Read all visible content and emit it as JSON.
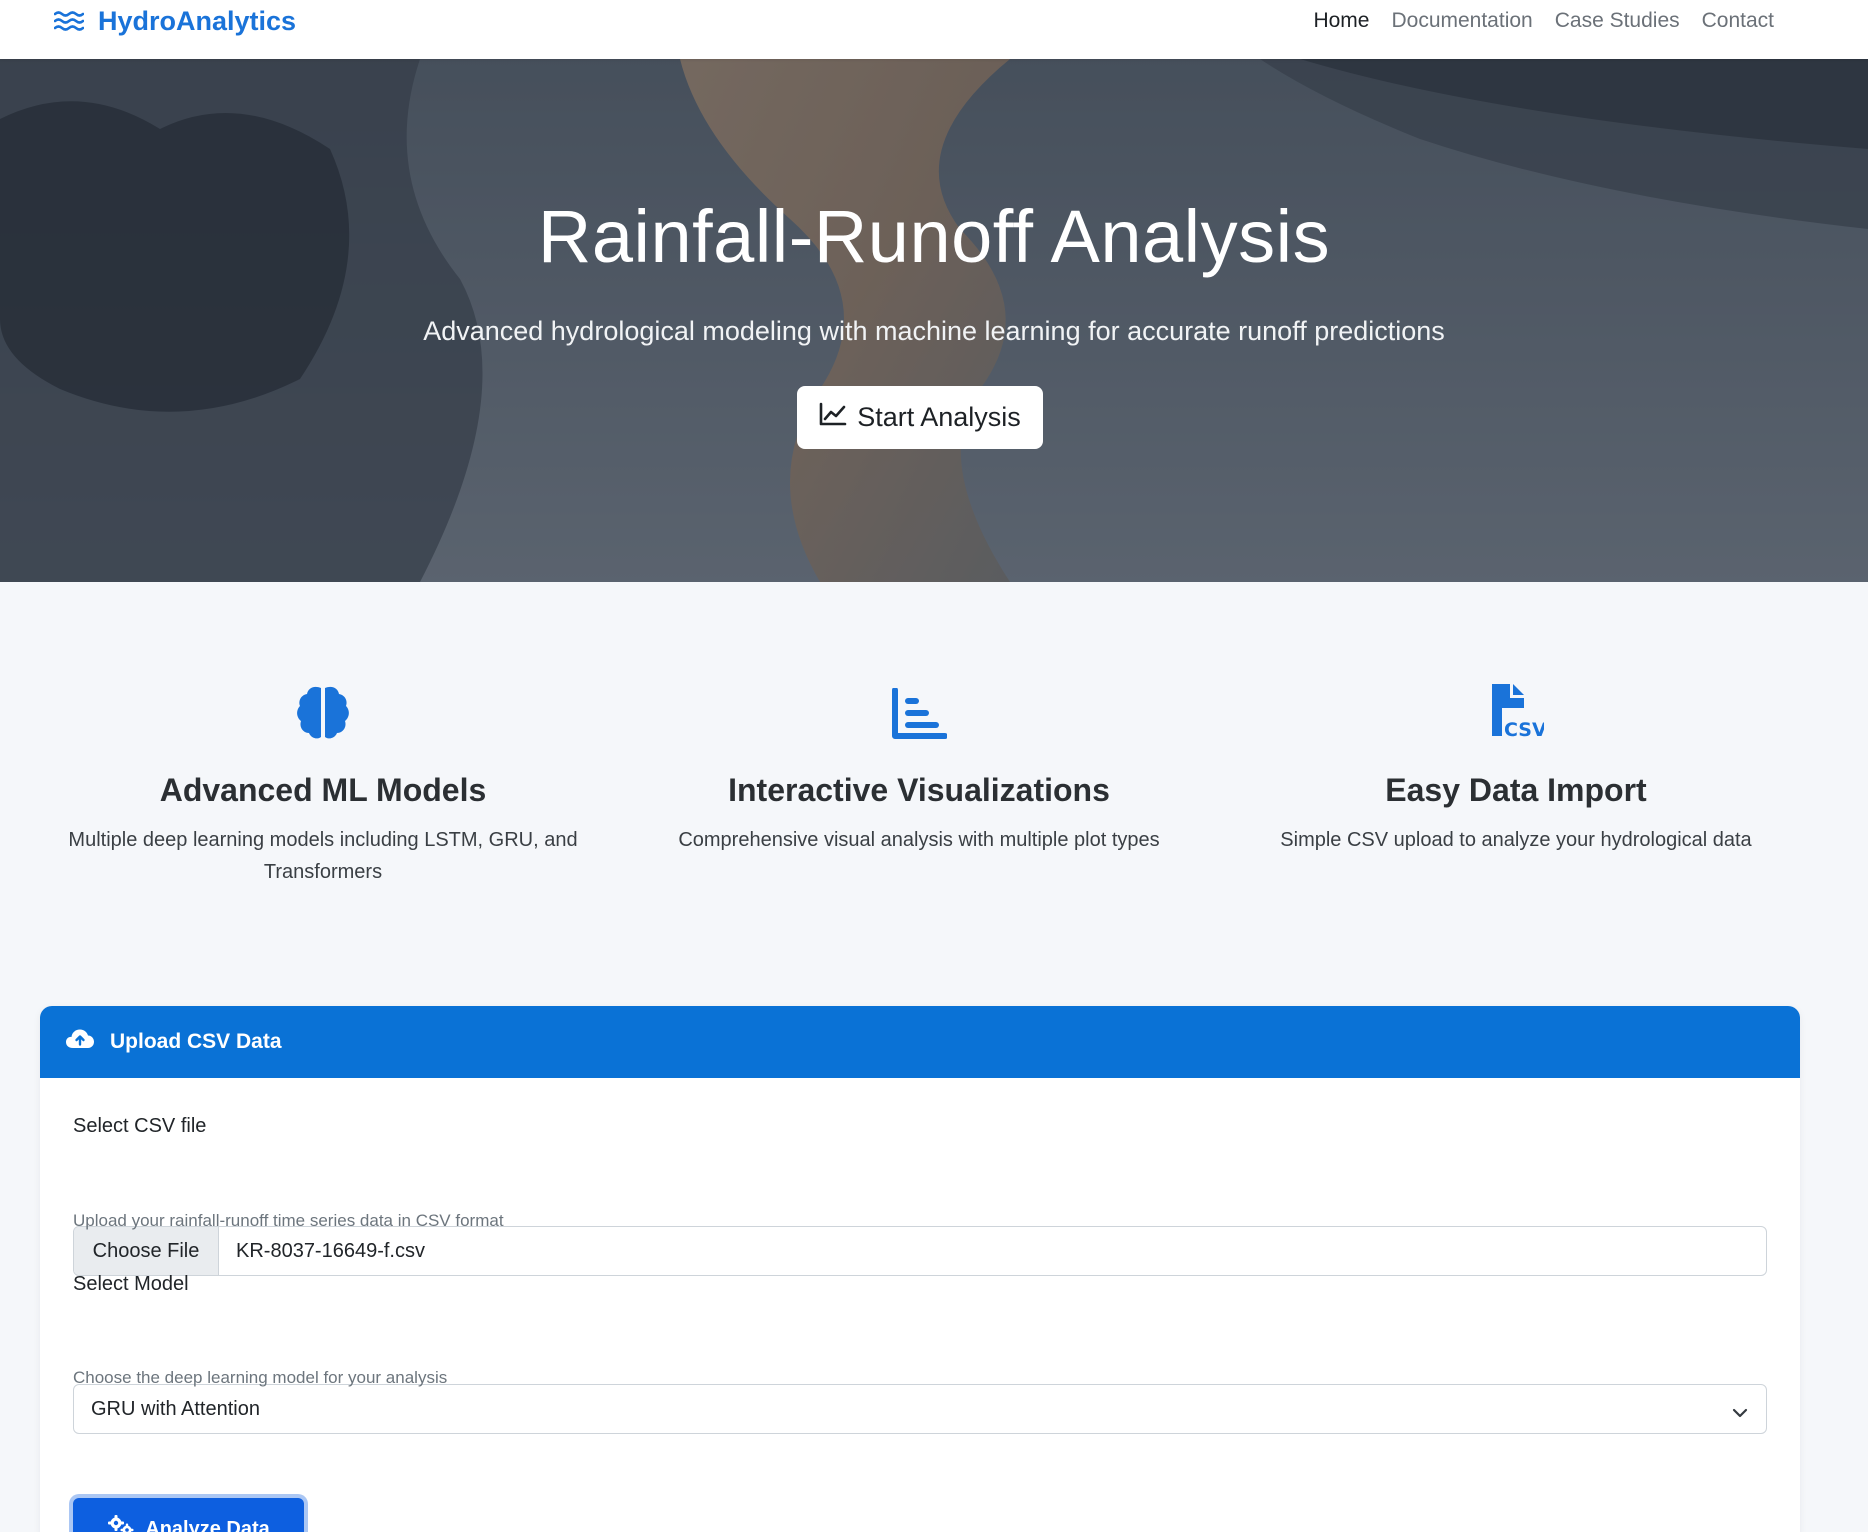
{
  "brand": {
    "name": "HydroAnalytics",
    "icon": "water-waves-icon",
    "color": "#1a73d9"
  },
  "nav": {
    "links": [
      {
        "label": "Home",
        "active": true
      },
      {
        "label": "Documentation",
        "active": false
      },
      {
        "label": "Case Studies",
        "active": false
      },
      {
        "label": "Contact",
        "active": false
      }
    ]
  },
  "hero": {
    "title": "Rainfall-Runoff Analysis",
    "subtitle": "Advanced hydrological modeling with machine learning for accurate runoff predictions",
    "button": {
      "label": "Start Analysis",
      "icon": "line-chart-icon"
    }
  },
  "features": [
    {
      "icon": "brain-icon",
      "title": "Advanced ML Models",
      "description": "Multiple deep learning models including LSTM, GRU, and Transformers"
    },
    {
      "icon": "bar-chart-icon",
      "title": "Interactive Visualizations",
      "description": "Comprehensive visual analysis with multiple plot types"
    },
    {
      "icon": "csv-file-icon",
      "title": "Easy Data Import",
      "description": "Simple CSV upload to analyze your hydrological data"
    }
  ],
  "upload": {
    "header": {
      "title": "Upload CSV Data",
      "icon": "cloud-upload-icon"
    },
    "file": {
      "label": "Select CSV file",
      "button_label": "Choose File",
      "filename": "KR-8037-16649-f.csv",
      "help": "Upload your rainfall-runoff time series data in CSV format"
    },
    "model": {
      "label": "Select Model",
      "selected": "GRU with Attention",
      "help": "Choose the deep learning model for your analysis"
    },
    "submit": {
      "label": "Analyze Data",
      "icon": "gears-icon"
    }
  },
  "colors": {
    "primary": "#0a72d6",
    "button_primary": "#0d5fe0",
    "page_background": "#f5f7fa"
  }
}
